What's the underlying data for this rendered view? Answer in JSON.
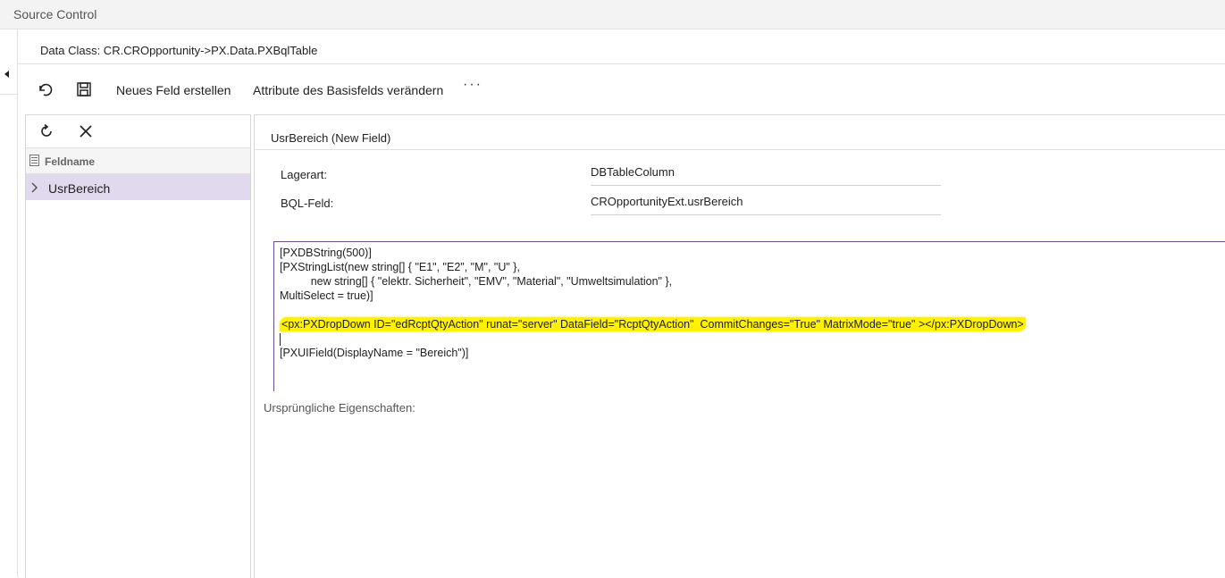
{
  "app": {
    "title": "Source Control"
  },
  "data_class": {
    "text": "Data Class: CR.CROpportunity->PX.Data.PXBqlTable"
  },
  "toolbar": {
    "undo_icon": "undo-icon",
    "save_icon": "save-icon",
    "new_field_label": "Neues Feld erstellen",
    "change_attrs_label": "Attribute des Basisfelds verändern",
    "more_label": "···"
  },
  "field_list": {
    "refresh_icon": "refresh-icon",
    "delete_icon": "close-icon",
    "column_header": "Feldname",
    "rows": [
      {
        "name": "UsrBereich"
      }
    ]
  },
  "detail": {
    "title": "UsrBereich (New Field)",
    "storage_label": "Lagerart:",
    "storage_value": "DBTableColumn",
    "bql_label": "BQL-Feld:",
    "bql_value": "CROpportunityExt.usrBereich",
    "code_lines": [
      "[PXDBString(500)]",
      "[PXStringList(new string[] { \"E1\", \"E2\", \"M\", \"U\" },",
      "          new string[] { \"elektr. Sicherheit\", \"EMV\", \"Material\", \"Umweltsimulation\" },",
      "MultiSelect = true)]",
      "",
      "<px:PXDropDown ID=\"edRcptQtyAction\" runat=\"server\" DataField=\"RcptQtyAction\"  CommitChanges=\"True\" MatrixMode=\"true\" ></px:PXDropDown>",
      "",
      "[PXUIField(DisplayName = \"Bereich\")]"
    ],
    "highlight_color": "#fff200",
    "original_props_label": "Ursprüngliche Eigenschaften:"
  }
}
